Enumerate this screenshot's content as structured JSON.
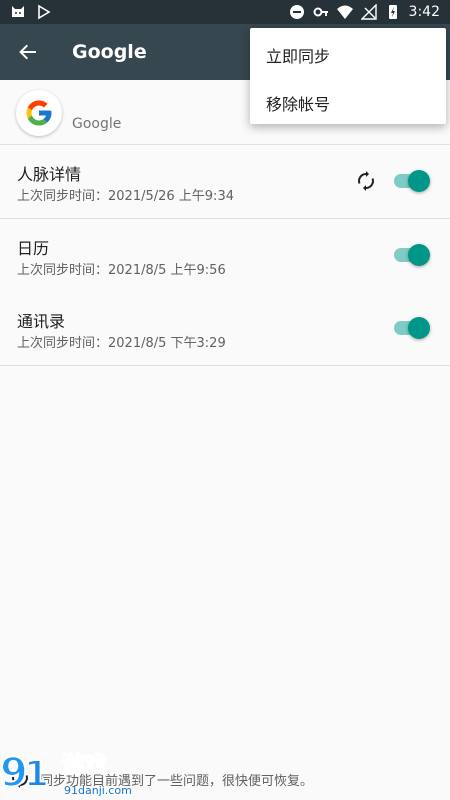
{
  "status_bar": {
    "time": "3:42"
  },
  "app_bar": {
    "title": "Google"
  },
  "account": {
    "label": "Google"
  },
  "sync_items": [
    {
      "title": "人脉详情",
      "last_sync": "上次同步时间：2021/5/26 上午9:34",
      "enabled": true,
      "syncing": true
    },
    {
      "title": "日历",
      "last_sync": "上次同步时间：2021/8/5 上午9:56",
      "enabled": true,
      "syncing": false
    },
    {
      "title": "通讯录",
      "last_sync": "上次同步时间：2021/8/5 下午3:29",
      "enabled": true,
      "syncing": false
    }
  ],
  "menu": {
    "items": [
      "立即同步",
      "移除帐号"
    ]
  },
  "footer": {
    "message": "同步功能目前遇到了一些问题，很快便可恢复。"
  },
  "watermark": {
    "brand": "游戏",
    "site": "91danji.com"
  },
  "colors": {
    "accent": "#009688",
    "appbar": "#37474f",
    "statusbar": "#263238"
  }
}
